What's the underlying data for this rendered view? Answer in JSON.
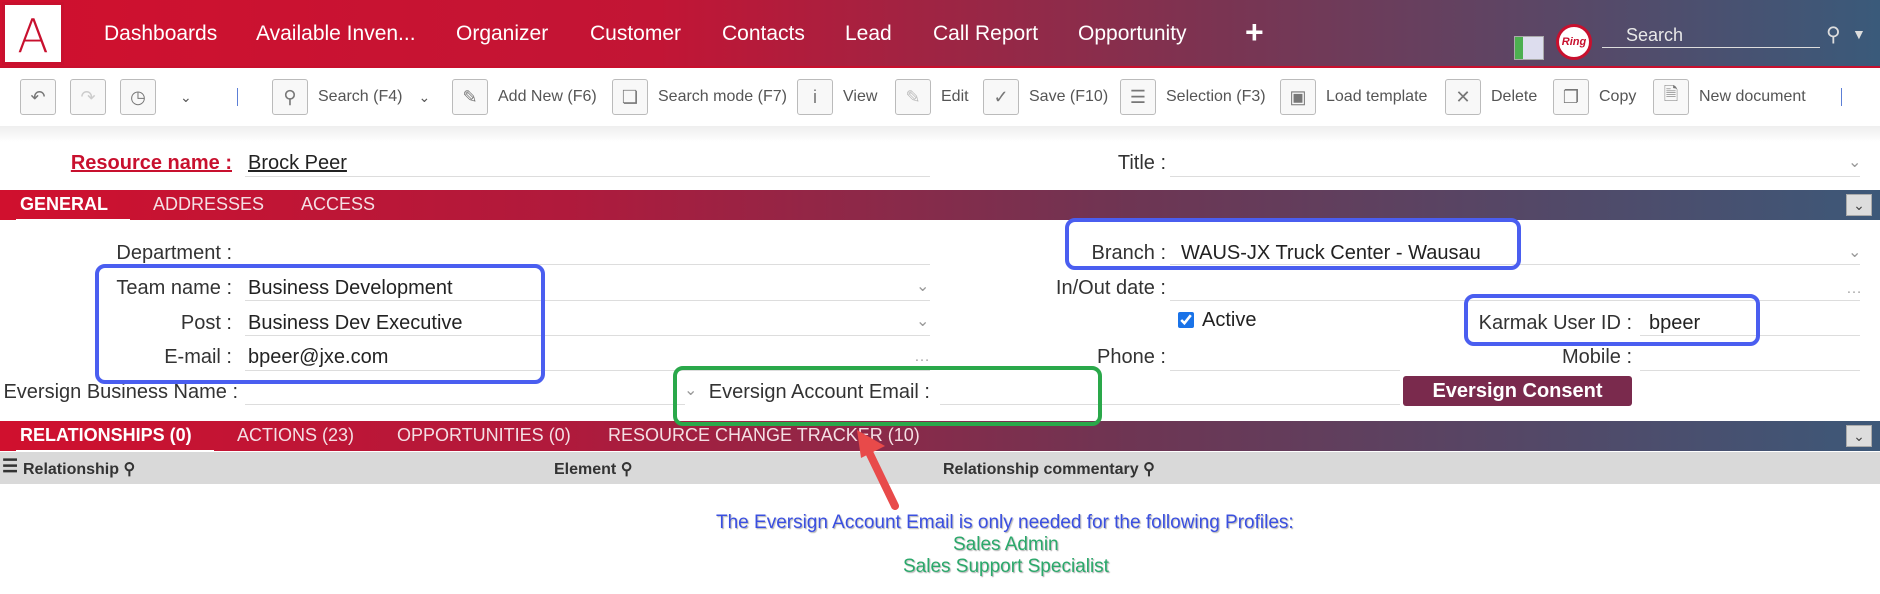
{
  "logo": {
    "letter": "A"
  },
  "nav": {
    "items": [
      "Dashboards",
      "Available Inven...",
      "Organizer",
      "Customer",
      "Contacts",
      "Lead",
      "Call Report",
      "Opportunity"
    ],
    "add_icon": "+",
    "ring_label": "Ring",
    "search_placeholder": "Search"
  },
  "toolbar": {
    "search": "Search (F4)",
    "add_new": "Add New (F6)",
    "search_mode": "Search mode (F7)",
    "view": "View",
    "edit": "Edit",
    "save": "Save (F10)",
    "selection": "Selection (F3)",
    "load_template": "Load template",
    "delete": "Delete",
    "copy": "Copy",
    "new_document": "New document"
  },
  "header": {
    "resource_label": "Resource name :",
    "resource_value": "Brock Peer",
    "title_label": "Title :",
    "title_value": ""
  },
  "tabs1": [
    "GENERAL",
    "ADDRESSES",
    "ACCESS"
  ],
  "general": {
    "department_label": "Department :",
    "department_value": "",
    "team_label": "Team name :",
    "team_value": "Business Development",
    "post_label": "Post :",
    "post_value": "Business Dev Executive",
    "email_label": "E-mail :",
    "email_value": "bpeer@jxe.com",
    "eversign_business_label": "Eversign Business Name :",
    "eversign_email_label": "Eversign Account Email :",
    "branch_label": "Branch :",
    "branch_value": "WAUS-JX Truck Center - Wausau",
    "inout_label": "In/Out date :",
    "active_label": "Active",
    "active_checked": true,
    "karmak_label": "Karmak User ID :",
    "karmak_value": "bpeer",
    "phone_label": "Phone :",
    "mobile_label": "Mobile :",
    "consent_button": "Eversign Consent"
  },
  "tabs2": [
    "RELATIONSHIPS (0)",
    "ACTIONS (23)",
    "OPPORTUNITIES (0)",
    "RESOURCE CHANGE TRACKER (10)"
  ],
  "grid": {
    "columns": [
      "Relationship",
      "Element",
      "Relationship commentary"
    ]
  },
  "annotation": {
    "line1": "The Eversign Account Email is only needed for the following Profiles:",
    "line2": "Sales Admin",
    "line3": "Sales Support Specialist"
  },
  "colors": {
    "brand": "#c8102e",
    "highlight_blue": "#4a5ef0",
    "highlight_green": "#2aa84a",
    "consent_button": "#7a2a4d"
  }
}
